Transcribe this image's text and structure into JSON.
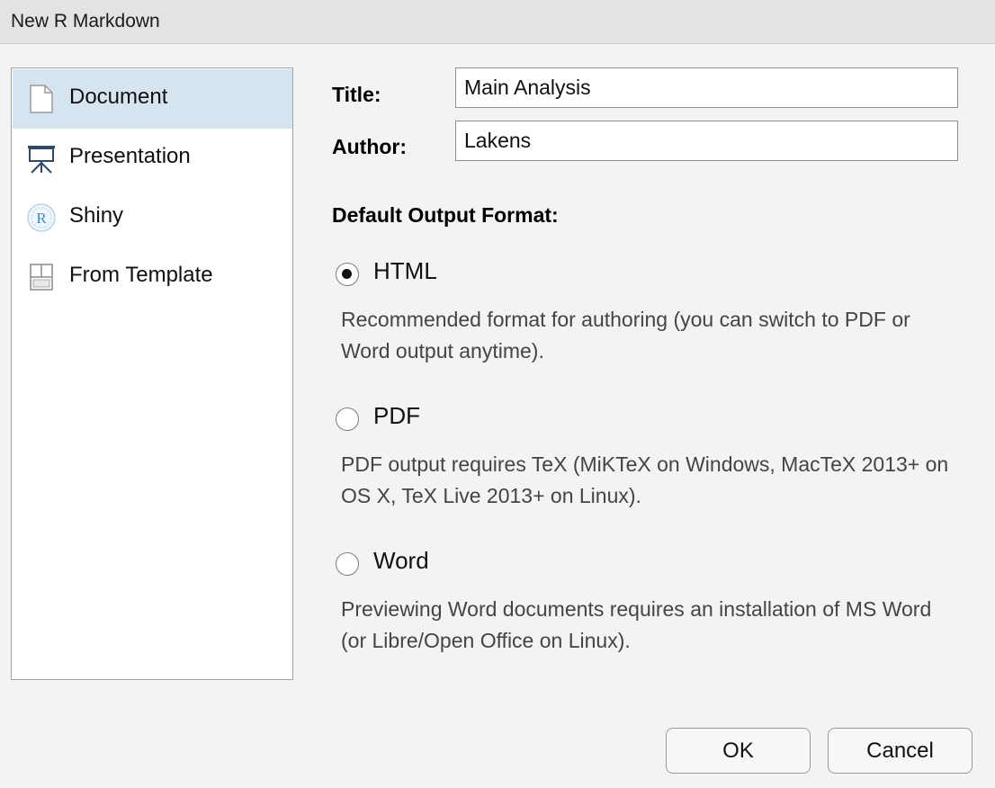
{
  "window": {
    "title": "New R Markdown"
  },
  "sidebar": {
    "items": [
      {
        "label": "Document",
        "icon": "document-icon",
        "selected": true
      },
      {
        "label": "Presentation",
        "icon": "presentation-icon",
        "selected": false
      },
      {
        "label": "Shiny",
        "icon": "shiny-icon",
        "selected": false
      },
      {
        "label": "From Template",
        "icon": "template-icon",
        "selected": false
      }
    ]
  },
  "form": {
    "title_label": "Title:",
    "title_value": "Main Analysis",
    "author_label": "Author:",
    "author_value": "Lakens"
  },
  "output_format": {
    "heading": "Default Output Format:",
    "selected": "HTML",
    "options": [
      {
        "label": "HTML",
        "description": "Recommended format for authoring (you can switch to PDF or Word output anytime)."
      },
      {
        "label": "PDF",
        "description": "PDF output requires TeX (MiKTeX on Windows, MacTeX 2013+ on OS X, TeX Live 2013+ on Linux)."
      },
      {
        "label": "Word",
        "description": "Previewing Word documents requires an installation of MS Word (or Libre/Open Office on Linux)."
      }
    ]
  },
  "buttons": {
    "ok": "OK",
    "cancel": "Cancel"
  },
  "colors": {
    "selected_bg": "#d6e4f0",
    "dialog_bg": "#f2f3f2",
    "shiny_icon": "#3a8fc9"
  }
}
